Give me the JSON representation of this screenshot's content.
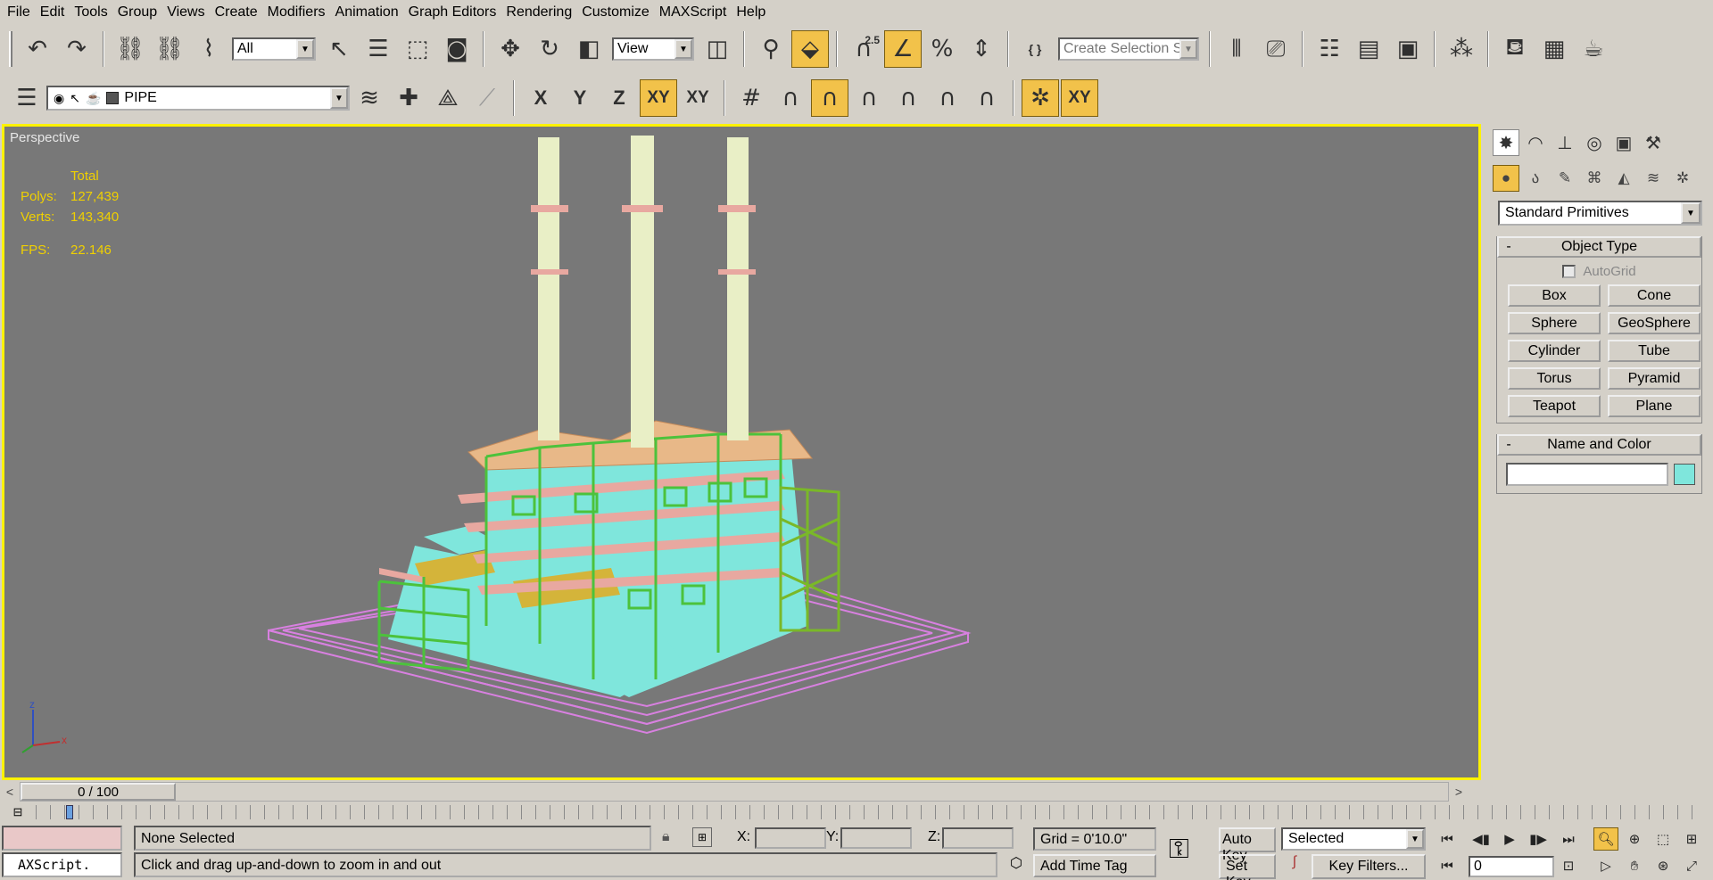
{
  "menu": [
    "File",
    "Edit",
    "Tools",
    "Group",
    "Views",
    "Create",
    "Modifiers",
    "Animation",
    "Graph Editors",
    "Rendering",
    "Customize",
    "MAXScript",
    "Help"
  ],
  "toolbar": {
    "selection_filter": "All",
    "ref_coord": "View",
    "named_selection_placeholder": "Create Selection Set",
    "snap_label": "2.5"
  },
  "layer_toolbar": {
    "layer_name": "PIPE"
  },
  "axis_constraints": {
    "x": "X",
    "y": "Y",
    "z": "Z",
    "xy": "XY",
    "xy_alt": "XY"
  },
  "viewport": {
    "label": "Perspective",
    "stats_header": "Total",
    "polys_label": "Polys:",
    "polys": "127,439",
    "verts_label": "Verts:",
    "verts": "143,340",
    "fps_label": "FPS:",
    "fps": "22.146",
    "axis_z": "z",
    "axis_x": "x",
    "axis_y": "y"
  },
  "command_panel": {
    "category": "Standard Primitives",
    "object_type_title": "Object Type",
    "autogrid": "AutoGrid",
    "primitives": [
      "Box",
      "Cone",
      "Sphere",
      "GeoSphere",
      "Cylinder",
      "Tube",
      "Torus",
      "Pyramid",
      "Teapot",
      "Plane"
    ],
    "name_color_title": "Name and Color",
    "object_color": "#7fe6dc"
  },
  "timeline": {
    "frame_display": "0 / 100"
  },
  "status": {
    "maxscript": "AXScript.",
    "selection": "None Selected",
    "prompt": "Click and drag up-and-down to zoom in and out",
    "x_label": "X:",
    "y_label": "Y:",
    "z_label": "Z:",
    "grid": "Grid = 0'10.0\"",
    "add_time_tag": "Add Time Tag",
    "auto_key": "Auto Key",
    "set_key": "Set Key",
    "key_mode": "Selected",
    "key_filters": "Key Filters...",
    "current_frame": "0"
  },
  "colors": {
    "viewport_bg": "#787878",
    "active_border": "#fcf200",
    "stats": "#f0d000",
    "active_button": "#f2c24a",
    "pipe_cyan": "#7fe6dc",
    "steel_green": "#4cc23c",
    "platform_pink": "#e8a8a0",
    "roof_orange": "#e8b888",
    "ground_magenta": "#d880e0",
    "stack_cream": "#e9efc6",
    "duct_yellow": "#d4b43a"
  }
}
